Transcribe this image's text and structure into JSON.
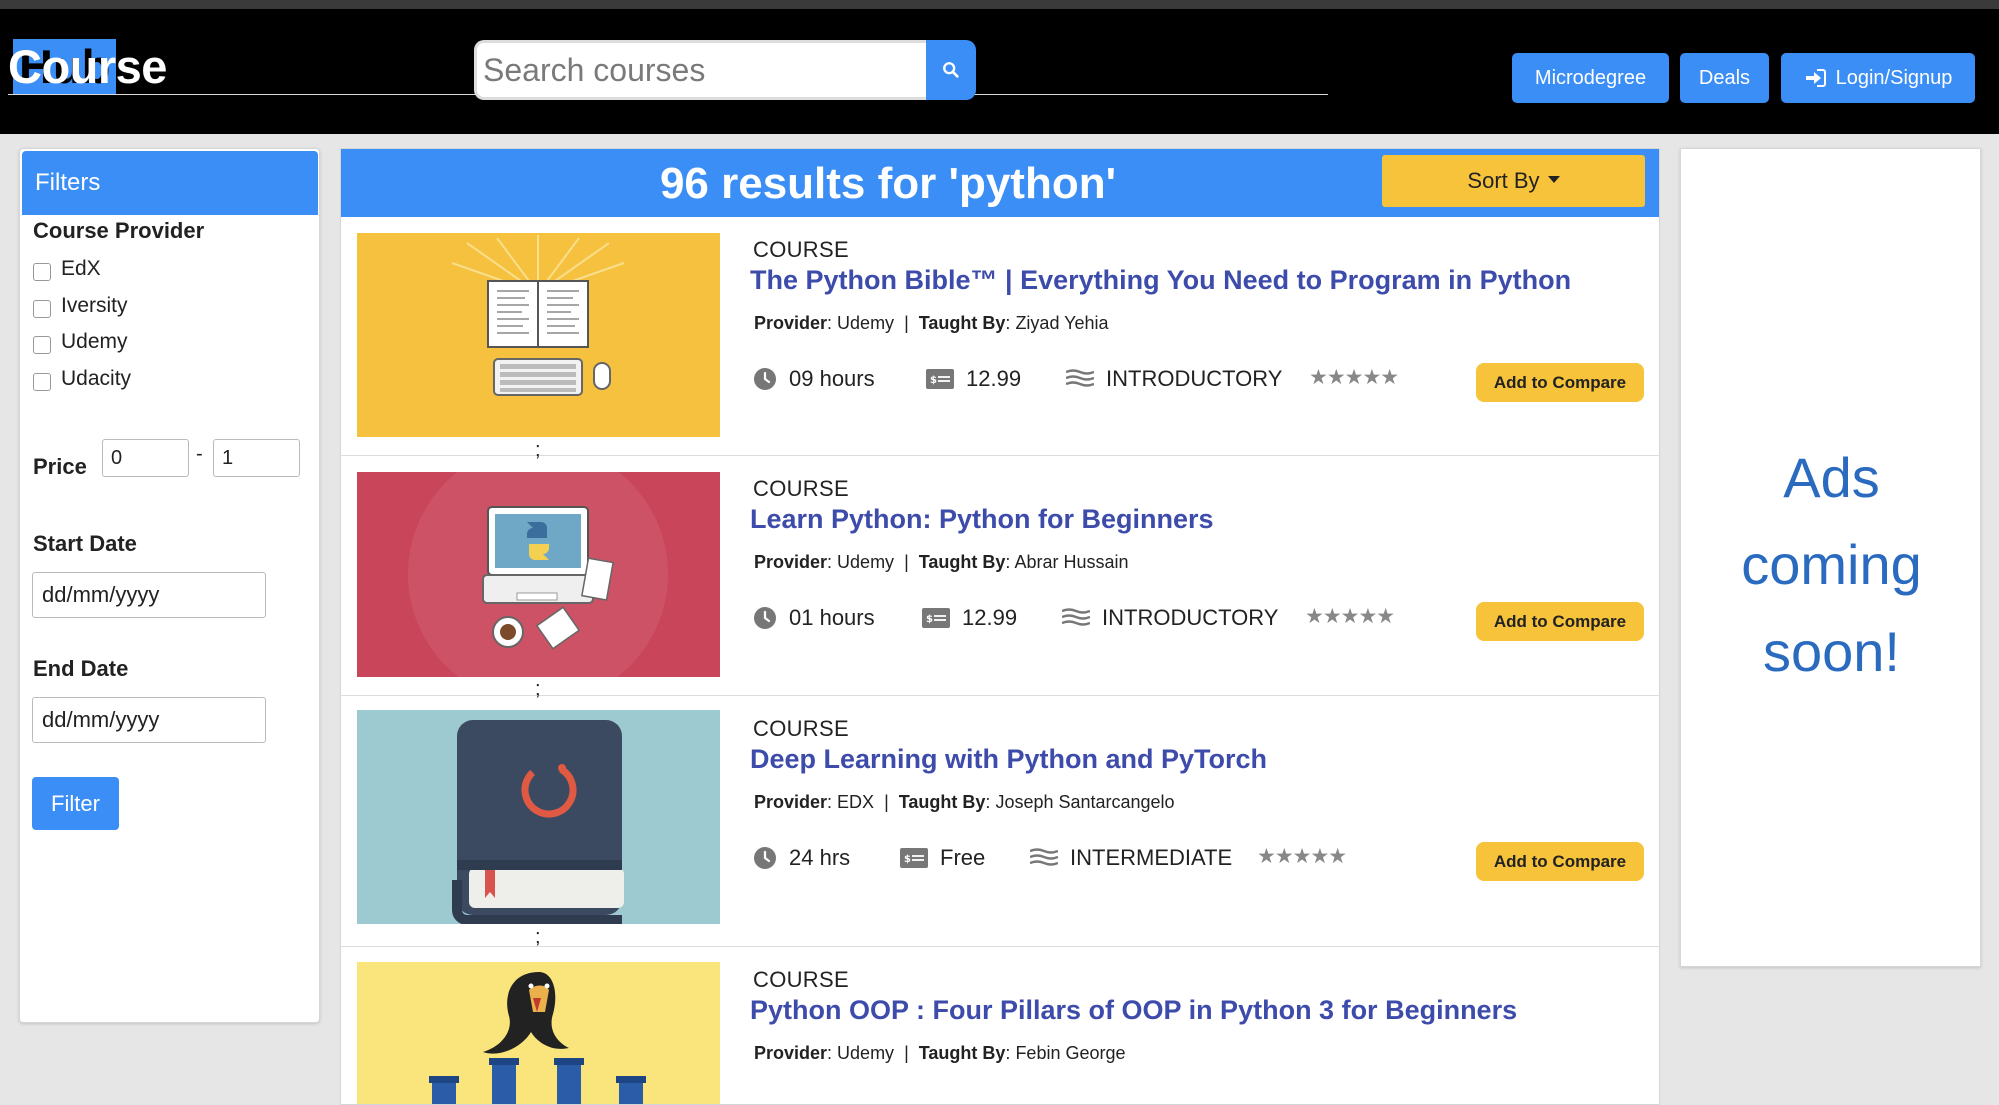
{
  "brand": {
    "part1": "Course",
    "part2": "Hub"
  },
  "search": {
    "placeholder": "Search courses"
  },
  "nav": {
    "microdegree": "Microdegree",
    "deals": "Deals",
    "login": "Login/Signup"
  },
  "filters": {
    "title": "Filters",
    "provider_title": "Course Provider",
    "providers": [
      "EdX",
      "Iversity",
      "Udemy",
      "Udacity"
    ],
    "price_label": "Price",
    "price_min": "0",
    "price_sep": "-",
    "price_max": "1",
    "start_date_label": "Start Date",
    "start_date_value": "dd/mm/yyyy",
    "end_date_label": "End Date",
    "end_date_value": "dd/mm/yyyy",
    "button": "Filter"
  },
  "results": {
    "heading": "96 results for 'python'",
    "sort_label": "Sort By",
    "courses": [
      {
        "type": "COURSE",
        "title": "The Python Bible™ | Everything You Need to Program in Python",
        "provider_label": "Provider",
        "provider": "Udemy",
        "taught_label": "Taught By",
        "instructor": "Ziyad Yehia",
        "duration": "09 hours",
        "price": "12.99",
        "level": "INTRODUCTORY",
        "stars": "★★★★★",
        "compare": "Add to Compare",
        "semicolon": ";",
        "thumb_color": "#f5c13f"
      },
      {
        "type": "COURSE",
        "title": "Learn Python: Python for Beginners",
        "provider_label": "Provider",
        "provider": "Udemy",
        "taught_label": "Taught By",
        "instructor": "Abrar Hussain",
        "duration": "01 hours",
        "price": "12.99",
        "level": "INTRODUCTORY",
        "stars": "★★★★★",
        "compare": "Add to Compare",
        "semicolon": ";",
        "thumb_color": "#c8455a"
      },
      {
        "type": "COURSE",
        "title": "Deep Learning with Python and PyTorch",
        "provider_label": "Provider",
        "provider": "EDX",
        "taught_label": "Taught By",
        "instructor": "Joseph Santarcangelo",
        "duration": "24 hrs",
        "price": "Free",
        "level": "INTERMEDIATE",
        "stars": "★★★★★",
        "compare": "Add to Compare",
        "semicolon": ";",
        "thumb_color": "#9dc9d0"
      },
      {
        "type": "COURSE",
        "title": "Python OOP : Four Pillars of OOP in Python 3 for Beginners",
        "provider_label": "Provider",
        "provider": "Udemy",
        "taught_label": "Taught By",
        "instructor": "Febin George",
        "thumb_color": "#fae57d"
      }
    ]
  },
  "ads": {
    "line1": "Ads",
    "line2": "coming",
    "line3": "soon!"
  }
}
